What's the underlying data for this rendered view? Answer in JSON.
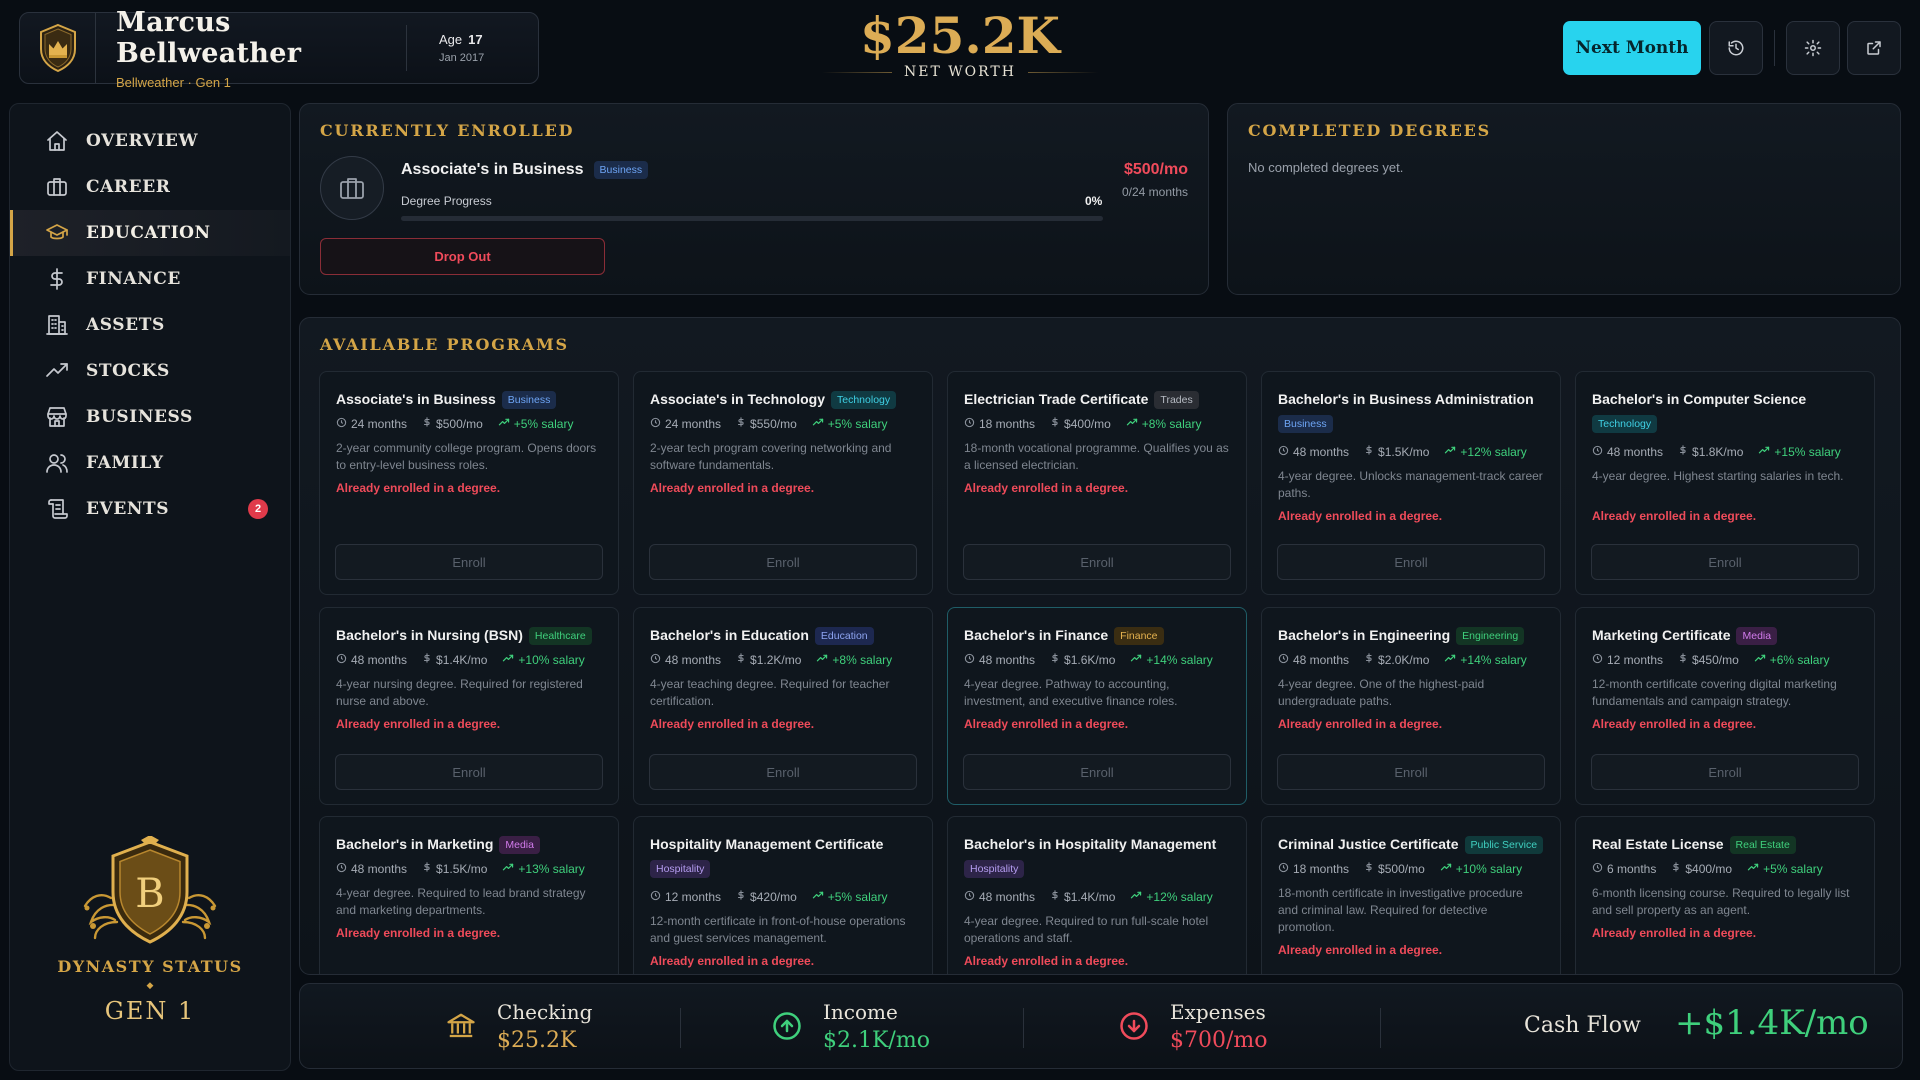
{
  "profile": {
    "name": "Marcus Bellweather",
    "subtitle": "Bellweather · Gen 1",
    "age_label": "Age",
    "age_value": "17",
    "date": "Jan 2017"
  },
  "networth": {
    "value": "$25.2K",
    "label": "NET WORTH"
  },
  "header": {
    "next_label": "Next Month"
  },
  "sidebar": {
    "items": [
      {
        "label": "OVERVIEW",
        "icon": "home-icon"
      },
      {
        "label": "CAREER",
        "icon": "briefcase-icon"
      },
      {
        "label": "EDUCATION",
        "icon": "graduation-cap-icon",
        "active": true
      },
      {
        "label": "FINANCE",
        "icon": "dollar-icon"
      },
      {
        "label": "ASSETS",
        "icon": "building-icon"
      },
      {
        "label": "STOCKS",
        "icon": "trend-up-icon"
      },
      {
        "label": "BUSINESS",
        "icon": "store-icon"
      },
      {
        "label": "FAMILY",
        "icon": "people-icon"
      },
      {
        "label": "EVENTS",
        "icon": "scroll-icon",
        "badge": "2"
      }
    ],
    "dynasty_title": "DYNASTY STATUS",
    "dynasty_gen": "GEN 1",
    "crest_letter": "B"
  },
  "enrolled": {
    "title": "CURRENTLY ENROLLED",
    "name": "Associate's in Business",
    "tag": "Business",
    "price": "$500/mo",
    "months": "0/24 months",
    "progress_label": "Degree Progress",
    "progress_pct": "0%",
    "progress_value": 0,
    "dropout_label": "Drop Out"
  },
  "completed": {
    "title": "COMPLETED DEGREES",
    "empty": "No completed degrees yet."
  },
  "programs": {
    "title": "AVAILABLE PROGRAMS",
    "warning": "Already enrolled in a degree.",
    "enroll_label": "Enroll",
    "items": [
      {
        "name": "Associate's in Business",
        "tag": "Business",
        "duration": "24 months",
        "cost": "$500/mo",
        "salary": "+5% salary",
        "desc": "2-year community college program. Opens doors to entry-level business roles."
      },
      {
        "name": "Associate's in Technology",
        "tag": "Technology",
        "duration": "24 months",
        "cost": "$550/mo",
        "salary": "+5% salary",
        "desc": "2-year tech program covering networking and software fundamentals."
      },
      {
        "name": "Electrician Trade Certificate",
        "tag": "Trades",
        "duration": "18 months",
        "cost": "$400/mo",
        "salary": "+8% salary",
        "desc": "18-month vocational programme. Qualifies you as a licensed electrician."
      },
      {
        "name": "Bachelor's in Business Administration",
        "tag": "Business",
        "duration": "48 months",
        "cost": "$1.5K/mo",
        "salary": "+12% salary",
        "desc": "4-year degree. Unlocks management-track career paths."
      },
      {
        "name": "Bachelor's in Computer Science",
        "tag": "Technology",
        "duration": "48 months",
        "cost": "$1.8K/mo",
        "salary": "+15% salary",
        "desc": "4-year degree. Highest starting salaries in tech."
      },
      {
        "name": "Bachelor's in Nursing (BSN)",
        "tag": "Healthcare",
        "duration": "48 months",
        "cost": "$1.4K/mo",
        "salary": "+10% salary",
        "desc": "4-year nursing degree. Required for registered nurse and above."
      },
      {
        "name": "Bachelor's in Education",
        "tag": "Education",
        "duration": "48 months",
        "cost": "$1.2K/mo",
        "salary": "+8% salary",
        "desc": "4-year teaching degree. Required for teacher certification."
      },
      {
        "name": "Bachelor's in Finance",
        "tag": "Finance",
        "duration": "48 months",
        "cost": "$1.6K/mo",
        "salary": "+14% salary",
        "desc": "4-year degree. Pathway to accounting, investment, and executive finance roles."
      },
      {
        "name": "Bachelor's in Engineering",
        "tag": "Engineering",
        "duration": "48 months",
        "cost": "$2.0K/mo",
        "salary": "+14% salary",
        "desc": "4-year degree. One of the highest-paid undergraduate paths."
      },
      {
        "name": "Marketing Certificate",
        "tag": "Media",
        "duration": "12 months",
        "cost": "$450/mo",
        "salary": "+6% salary",
        "desc": "12-month certificate covering digital marketing fundamentals and campaign strategy."
      },
      {
        "name": "Bachelor's in Marketing",
        "tag": "Media",
        "duration": "48 months",
        "cost": "$1.5K/mo",
        "salary": "+13% salary",
        "desc": "4-year degree. Required to lead brand strategy and marketing departments."
      },
      {
        "name": "Hospitality Management Certificate",
        "tag": "Hospitality",
        "duration": "12 months",
        "cost": "$420/mo",
        "salary": "+5% salary",
        "desc": "12-month certificate in front-of-house operations and guest services management."
      },
      {
        "name": "Bachelor's in Hospitality Management",
        "tag": "Hospitality",
        "duration": "48 months",
        "cost": "$1.4K/mo",
        "salary": "+12% salary",
        "desc": "4-year degree. Required to run full-scale hotel operations and staff."
      },
      {
        "name": "Criminal Justice Certificate",
        "tag": "Public Service",
        "duration": "18 months",
        "cost": "$500/mo",
        "salary": "+10% salary",
        "desc": "18-month certificate in investigative procedure and criminal law. Required for detective promotion."
      },
      {
        "name": "Real Estate License",
        "tag": "Real Estate",
        "duration": "6 months",
        "cost": "$400/mo",
        "salary": "+5% salary",
        "desc": "6-month licensing course. Required to legally list and sell property as an agent."
      }
    ]
  },
  "bottom": {
    "checking_label": "Checking",
    "checking_value": "$25.2K",
    "income_label": "Income",
    "income_value": "$2.1K/mo",
    "expenses_label": "Expenses",
    "expenses_value": "$700/mo",
    "cashflow_label": "Cash Flow",
    "cashflow_value": "+$1.4K/mo"
  },
  "colors": {
    "gold": "#d4a547",
    "accent": "#28d3ee",
    "positive": "#3fd07c",
    "negative": "#f04b5b"
  }
}
